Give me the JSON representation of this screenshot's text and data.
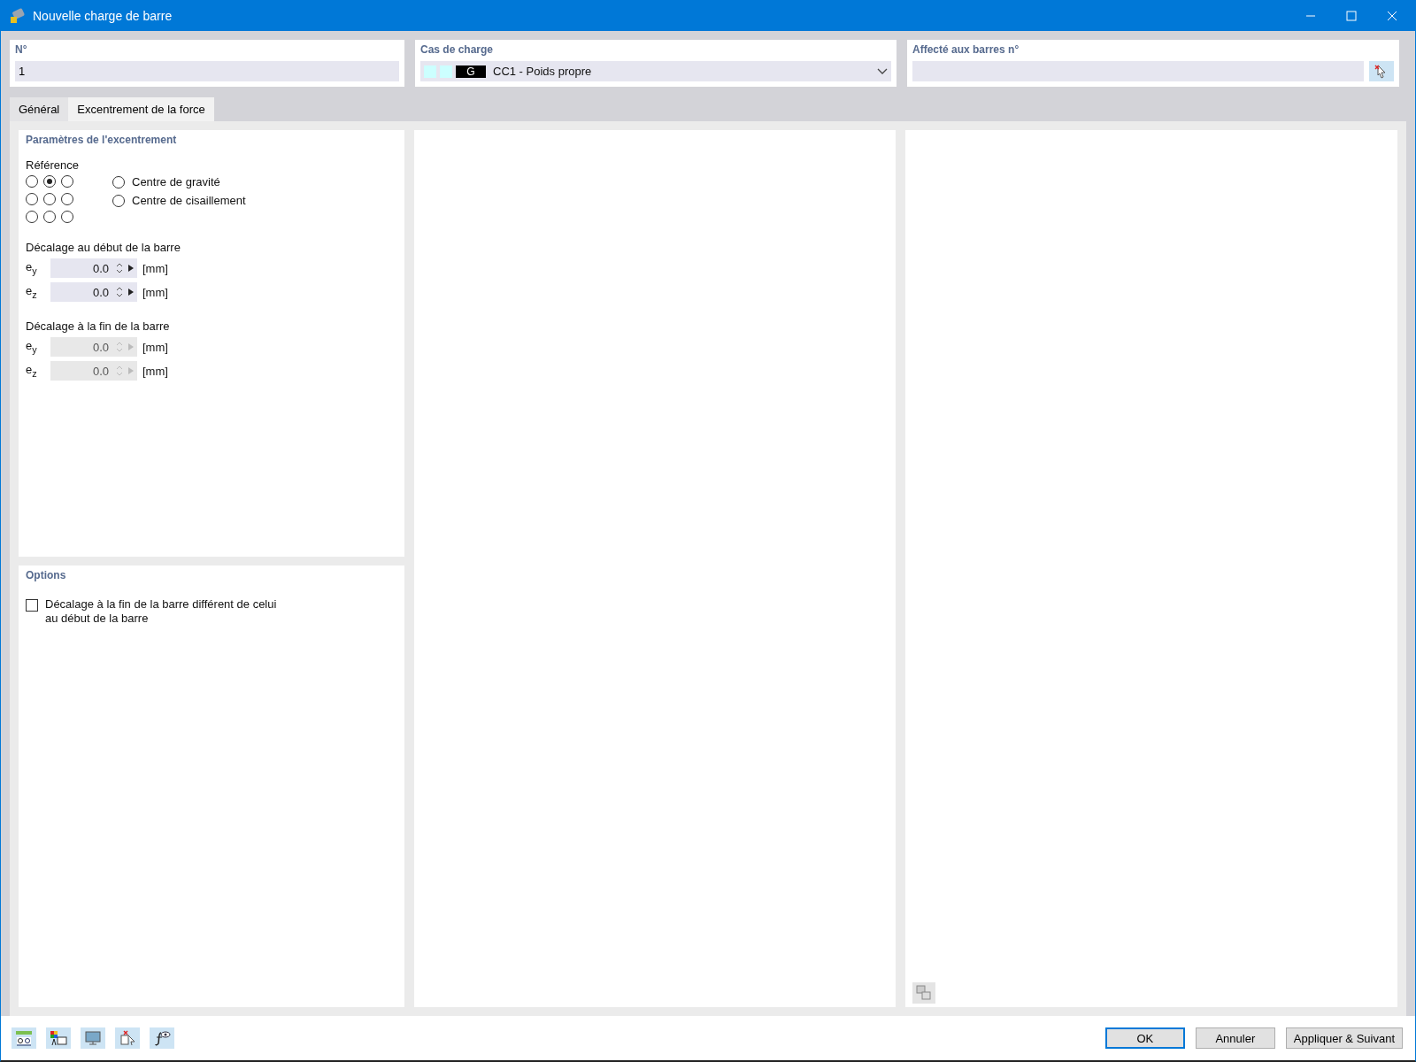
{
  "window": {
    "title": "Nouvelle charge de barre"
  },
  "header": {
    "number": {
      "label": "N°",
      "value": "1"
    },
    "load_case": {
      "label": "Cas de charge",
      "swatches": [
        {
          "color": "#ccffff"
        },
        {
          "color": "#ccffff"
        }
      ],
      "tag": "G",
      "value": "CC1 - Poids propre"
    },
    "assigned": {
      "label": "Affecté aux barres n°"
    }
  },
  "tabs": [
    {
      "label": "Général",
      "selected": false
    },
    {
      "label": "Excentrement de la force",
      "selected": true
    }
  ],
  "parameters": {
    "title": "Paramètres de l'excentrement",
    "reference_label": "Référence",
    "grid": [
      {
        "selected": false
      },
      {
        "selected": true
      },
      {
        "selected": false
      },
      {
        "selected": false
      },
      {
        "selected": false
      },
      {
        "selected": false
      },
      {
        "selected": false
      },
      {
        "selected": false
      },
      {
        "selected": false
      }
    ],
    "options": [
      {
        "label": "Centre de gravité",
        "selected": false
      },
      {
        "label": "Centre de cisaillement",
        "selected": false
      }
    ],
    "groups": [
      {
        "title": "Décalage au début de la barre",
        "rows": [
          {
            "symbol": "e$_{y}$",
            "value": "0.0",
            "unit": "[mm]",
            "disabled": false
          },
          {
            "symbol": "e$_{z}$",
            "value": "0.0",
            "unit": "[mm]",
            "disabled": false
          }
        ]
      },
      {
        "title": "Décalage à la fin de la barre",
        "rows": [
          {
            "symbol": "e$_{y}$",
            "value": "0.0",
            "unit": "[mm]",
            "disabled": true
          },
          {
            "symbol": "e$_{z}$",
            "value": "0.0",
            "unit": "[mm]",
            "disabled": true
          }
        ]
      }
    ]
  },
  "options": {
    "title": "Options",
    "checkbox": {
      "label": "Décalage à la fin de la barre différent de celui au début de la barre",
      "checked": false
    }
  },
  "buttons": [
    "OK",
    "Annuler",
    "Appliquer & Suivant"
  ]
}
